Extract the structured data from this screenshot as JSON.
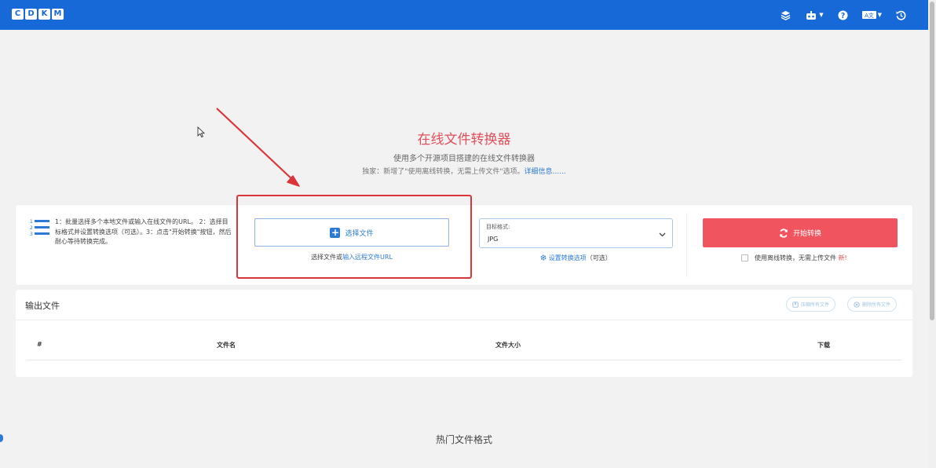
{
  "header": {
    "logo_letters": [
      "C",
      "D",
      "K",
      "M"
    ],
    "icons": [
      "layers-icon",
      "robot-icon",
      "help-icon",
      "language-icon",
      "history-icon"
    ],
    "language_label": "A文"
  },
  "hero": {
    "title": "在线文件转换器",
    "subtitle": "使用多个开源项目搭建的在线文件转换器",
    "note_prefix": "独家：新增了\"使用离线转换，无需上传文件\"选项。",
    "note_link": "详细信息......"
  },
  "converter": {
    "steps": "1：批量选择多个本地文件或输入在线文件的URL。 2：选择目标格式并设置转换选项（可选）。3：点击\"开始转换\"按钮，然后耐心等待转换完成。",
    "select_button": "选择文件",
    "select_hint_prefix": "选择文件或",
    "select_hint_link": "输入远程文件URL",
    "format_label": "目标格式:",
    "format_value": "JPG",
    "options_link": "设置转换选项",
    "options_suffix": "（可选）",
    "start_button": "开始转换",
    "offline_label": "使用离线转换，无需上传文件",
    "new_badge": "新!"
  },
  "output": {
    "title": "输出文件",
    "compress_button": "压缩所有文件",
    "delete_button": "删除所有文件",
    "columns": [
      "#",
      "文件名",
      "文件大小",
      "下载"
    ]
  },
  "popular": {
    "title": "热门文件格式"
  },
  "colors": {
    "header_bg": "#1769d8",
    "accent_red": "#f0555f",
    "title_red": "#e0505a",
    "link_blue": "#2b7bd6",
    "highlight": "#d9353a"
  }
}
